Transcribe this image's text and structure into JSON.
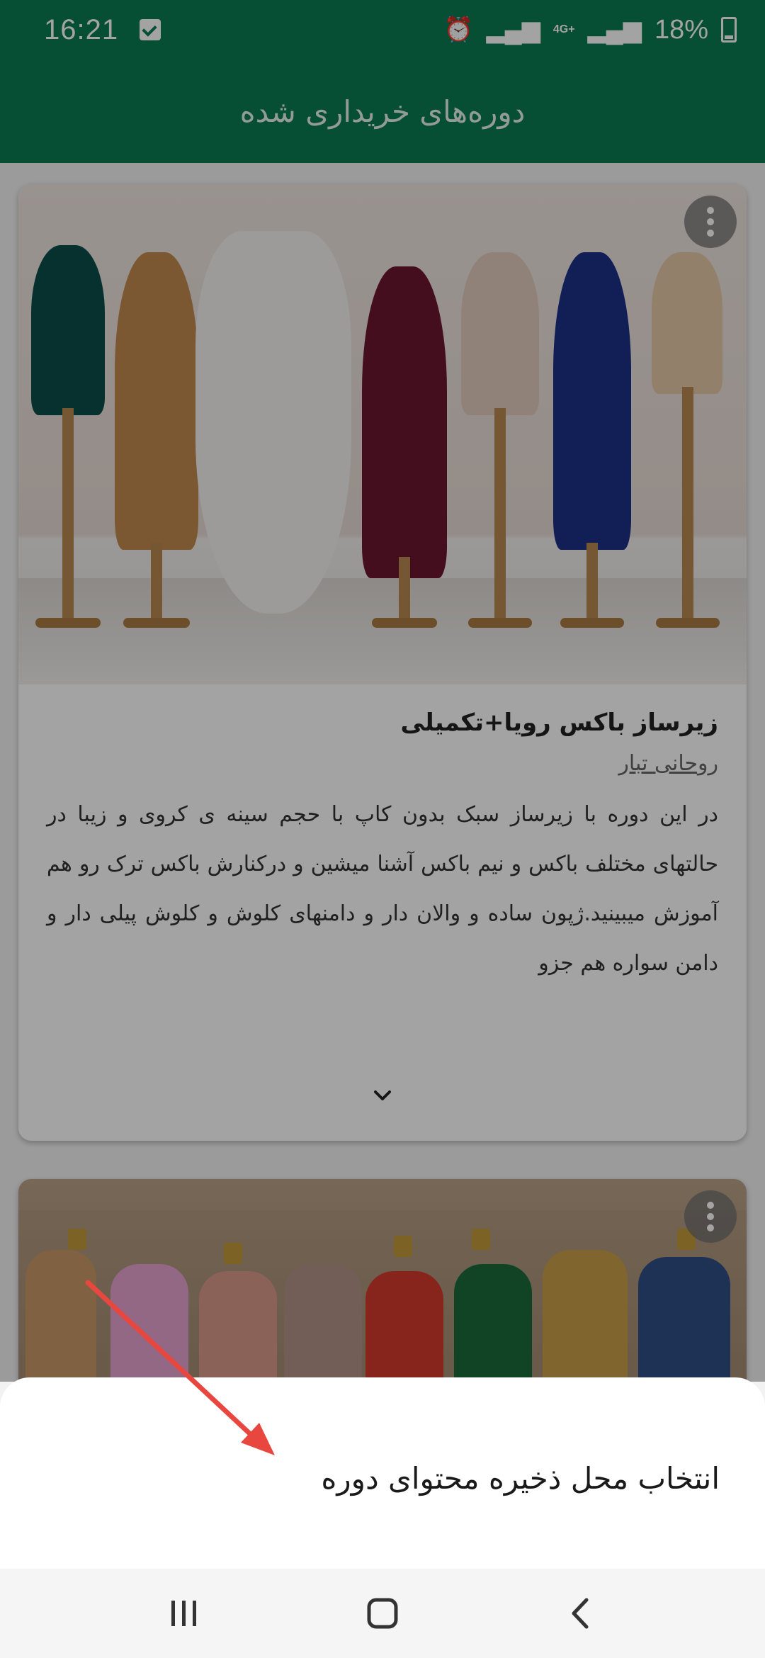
{
  "status_bar": {
    "time": "16:21",
    "network": "4G+",
    "battery": "18%"
  },
  "app_bar": {
    "title": "دوره‌های خریداری شده"
  },
  "courses": [
    {
      "title": "زیرساز باکس رویا+تکمیلی",
      "author": "روحانی تبار",
      "description": "در این دوره با زیرساز سبک بدون کاپ با حجم سینه ی کروی و زیبا در حالتهای مختلف باکس و نیم باکس آشنا میشین و درکنارش باکس ترک رو هم آموزش میبینید.ژپون  ساده و والان دار و دامنهای کلوش و کلوش پیلی دار و دامن سواره هم جزو"
    }
  ],
  "bottom_sheet": {
    "option_label": "انتخاب محل ذخیره محتوای دوره"
  },
  "colors": {
    "primary": "#0a7a52",
    "annotation_arrow": "#e8473f"
  },
  "icons": {
    "more": "more-vert-icon",
    "expand": "chevron-down-icon",
    "nav_recents": "recents-icon",
    "nav_home": "home-icon",
    "nav_back": "back-icon"
  }
}
